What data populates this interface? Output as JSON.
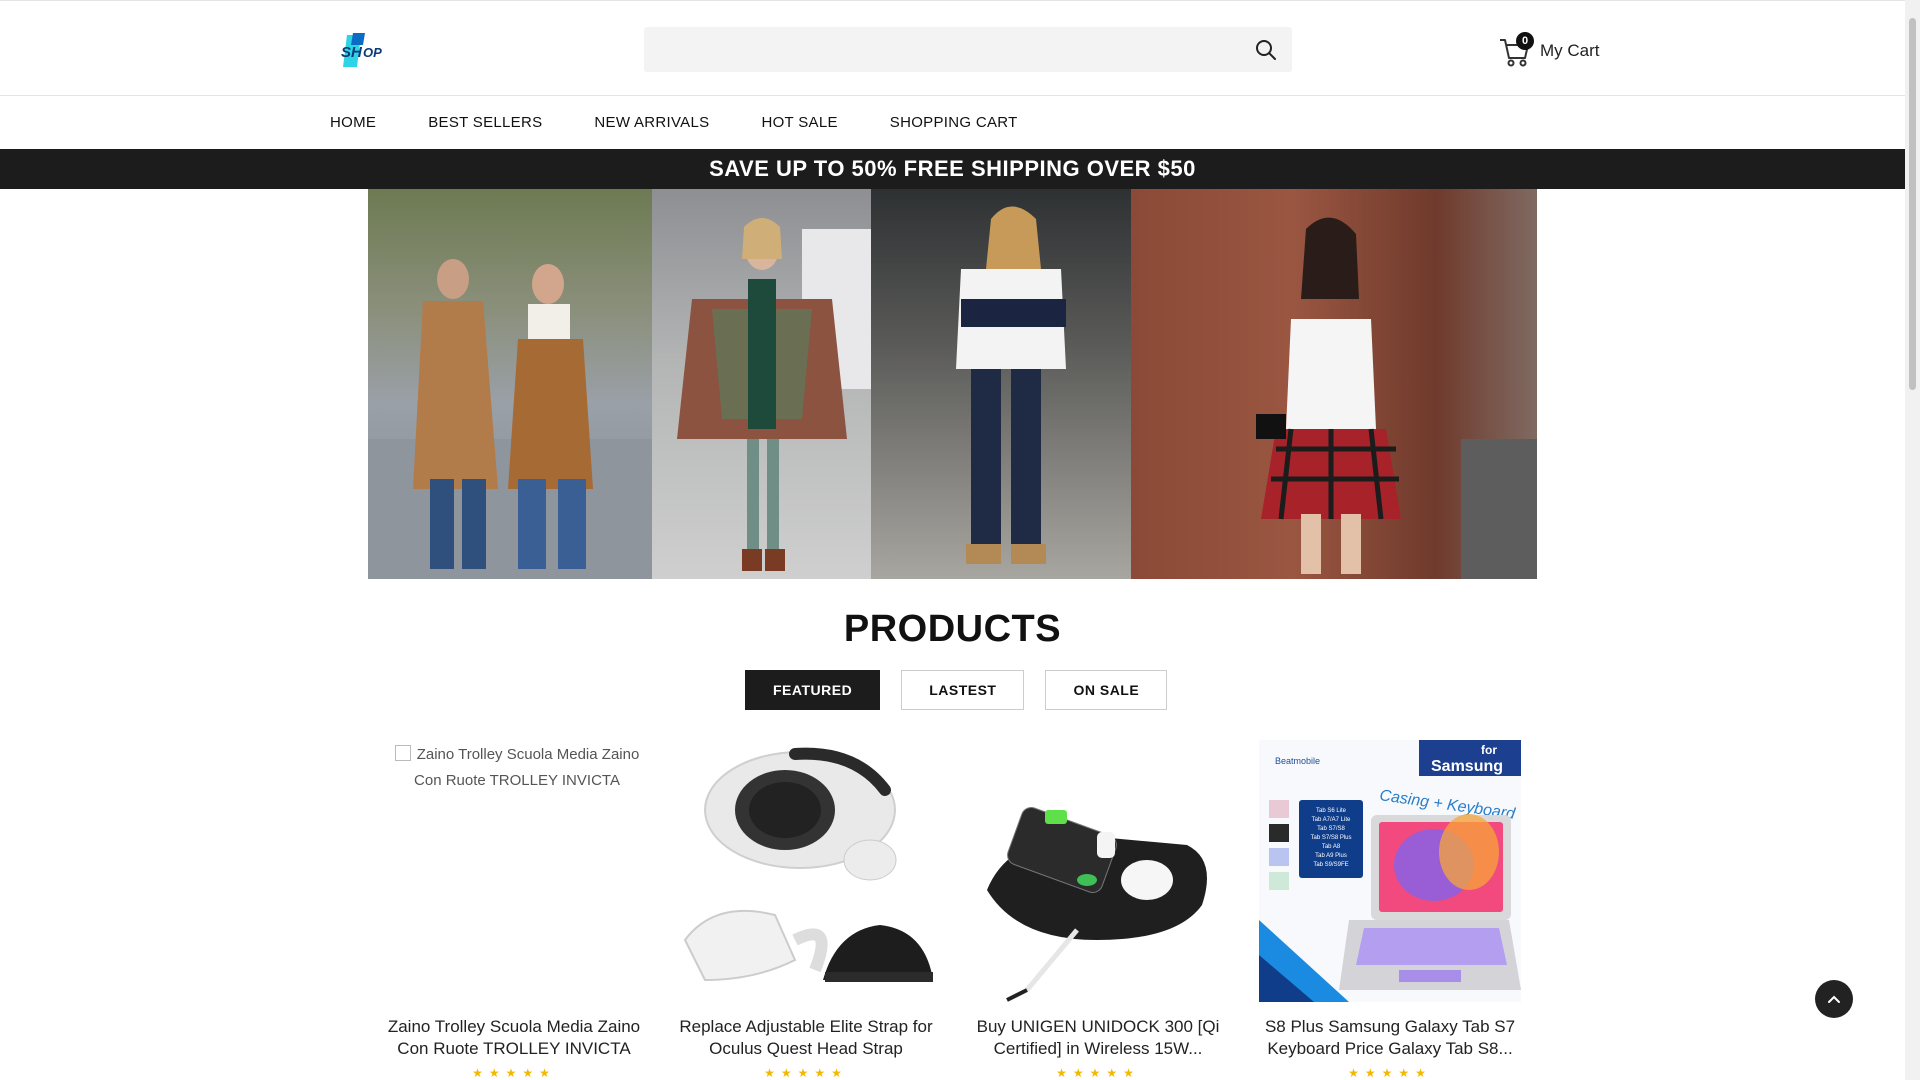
{
  "header": {
    "logo_text": "SHOP",
    "search": {
      "placeholder": "",
      "value": ""
    },
    "cart": {
      "count": "0",
      "label": "My Cart"
    }
  },
  "nav": {
    "items": [
      "HOME",
      "BEST SELLERS",
      "NEW ARRIVALS",
      "HOT SALE",
      "SHOPPING CART"
    ]
  },
  "promo": {
    "text": "SAVE UP TO 50% FREE SHIPPING OVER $50"
  },
  "products": {
    "title": "PRODUCTS",
    "tabs": [
      {
        "label": "FEATURED",
        "active": true
      },
      {
        "label": "LASTEST",
        "active": false
      },
      {
        "label": "ON SALE",
        "active": false
      }
    ],
    "items": [
      {
        "image_alt": "Zaino Trolley Scuola Media Zaino Con Ruote TROLLEY INVICTA",
        "title": "Zaino Trolley Scuola Media Zaino Con Ruote TROLLEY INVICTA",
        "rating": "★★★★★"
      },
      {
        "image_alt": "",
        "title": "Replace Adjustable Elite Strap for Oculus Quest Head Strap",
        "rating": "★★★★★"
      },
      {
        "image_alt": "",
        "title": "Buy UNIGEN UNIDOCK 300 [Qi Certified] in Wireless 15W...",
        "rating": "★★★★★"
      },
      {
        "image_alt": "",
        "title": "S8 Plus Samsung Galaxy Tab S7 Keyboard Price Galaxy Tab S8...",
        "rating": "★★★★★"
      }
    ],
    "samsung_ad": {
      "brand": "Beatmobile",
      "for_text": "for",
      "samsung_text": "Samsung",
      "tagline": "Casing + Keyboard",
      "models": [
        "Tab S6 Lite",
        "Tab A7/A7 Lite",
        "Tab S7/S8",
        "Tab S7/S8 Plus",
        "Tab A8",
        "Tab A9 Plus",
        "Tab S9/S9FE"
      ]
    }
  },
  "colors": {
    "primary_dark": "#1c1c1c",
    "star": "#f2b900",
    "logo_blue": "#0a6cc4",
    "logo_cyan": "#2fd3e6"
  }
}
